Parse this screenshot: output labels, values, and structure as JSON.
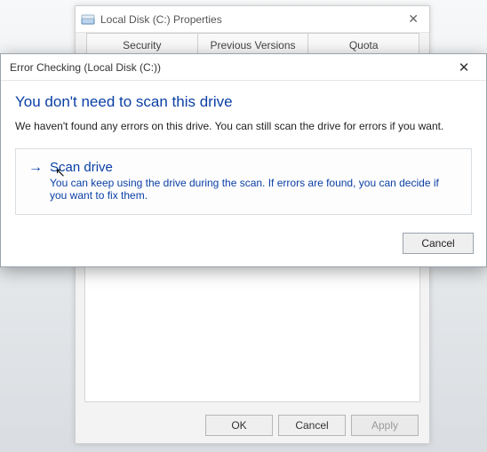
{
  "props_window": {
    "title": "Local Disk (C:) Properties",
    "tabs": {
      "security": "Security",
      "previous": "Previous Versions",
      "quota": "Quota"
    },
    "buttons": {
      "ok": "OK",
      "cancel": "Cancel",
      "apply": "Apply"
    }
  },
  "dialog": {
    "title": "Error Checking (Local Disk (C:))",
    "headline": "You don't need to scan this drive",
    "message": "We haven't found any errors on this drive. You can still scan the drive for errors if you want.",
    "option": {
      "title": "Scan drive",
      "desc": "You can keep using the drive during the scan. If errors are found, you can decide if you want to fix them."
    },
    "cancel": "Cancel"
  }
}
